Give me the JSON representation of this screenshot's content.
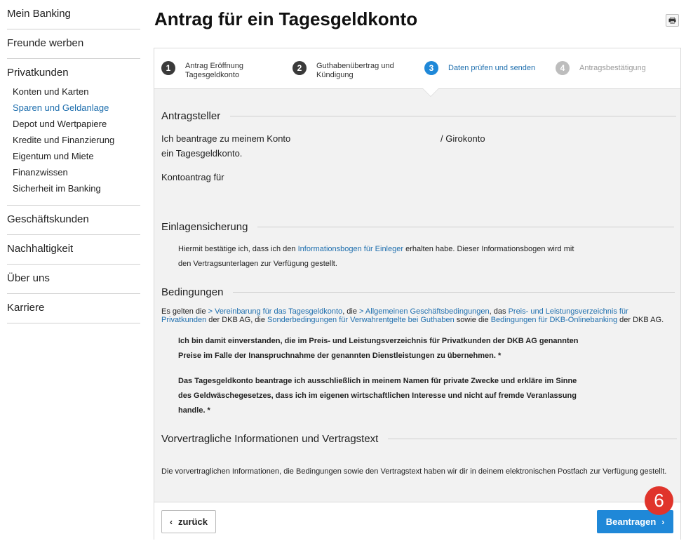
{
  "sidebar": {
    "top_items": [
      "Mein Banking",
      "Freunde werben"
    ],
    "privatkunden": {
      "label": "Privatkunden",
      "items": [
        "Konten und Karten",
        "Sparen und Geldanlage",
        "Depot und Wertpapiere",
        "Kredite und Finanzierung",
        "Eigentum und Miete",
        "Finanzwissen",
        "Sicherheit im Banking"
      ]
    },
    "bottom_items": [
      "Geschäftskunden",
      "Nachhaltigkeit",
      "Über uns",
      "Karriere"
    ]
  },
  "page": {
    "title": "Antrag für ein Tagesgeldkonto",
    "print_icon": "🖶"
  },
  "steps": [
    {
      "num": "1",
      "label": "Antrag Eröffnung Tagesgeldkonto",
      "state": "done"
    },
    {
      "num": "2",
      "label": "Guthabenübertrag und Kündigung",
      "state": "done"
    },
    {
      "num": "3",
      "label": "Daten prüfen und senden",
      "state": "current"
    },
    {
      "num": "4",
      "label": "Antragsbestätigung",
      "state": "future"
    }
  ],
  "antragsteller": {
    "title": "Antragsteller",
    "line1": "Ich beantrage zu meinem Konto",
    "line1_suffix": "/ Girokonto",
    "line2": "ein Tagesgeldkonto.",
    "line3": "Kontoantrag für"
  },
  "einlagensicherung": {
    "title": "Einlagensicherung",
    "text_before": "Hiermit bestätige ich, dass ich den ",
    "link": "Informationsbogen für Einleger",
    "text_after": " erhalten habe. Dieser Informationsbogen wird mit",
    "line2": "den Vertragsunterlagen zur Verfügung gestellt."
  },
  "bedingungen": {
    "title": "Bedingungen",
    "p1": "Es gelten die ",
    "l1": "> Vereinbarung für das Tagesgeldkonto",
    "p2": ", die ",
    "l2": "> Allgemeinen Geschäftsbedingungen",
    "p3": ", das ",
    "l3": "Preis- und Leistungsverzeichnis für Privatkunden",
    "p4": " der DKB AG, die ",
    "l4": "Sonderbedingungen für Verwahrentgelte bei Guthaben",
    "p5": " sowie die ",
    "l5": "Bedingungen für DKB-Onlinebanking",
    "p6": " der DKB AG.",
    "bold1": "Ich bin damit einverstanden, die im Preis- und Leistungsverzeichnis für Privatkunden der DKB AG genannten Preise im Falle der Inanspruchnahme der genannten Dienstleistungen zu übernehmen. *",
    "bold2": "Das Tagesgeldkonto beantrage ich ausschließlich in meinem Namen für private Zwecke und erkläre im Sinne des Geldwäschegesetzes, dass ich im eigenen wirtschaftlichen Interesse und nicht auf fremde Veranlassung handle. *"
  },
  "vorvertraglich": {
    "title": "Vorvertragliche Informationen und Vertragstext",
    "text": "Die vorvertraglichen Informationen, die Bedingungen sowie den Vertragstext haben wir dir in deinem elektronischen Postfach zur Verfügung gestellt."
  },
  "footer": {
    "back_label": "zurück",
    "next_label": "Beantragen",
    "chev_left": "‹",
    "chev_right": "›",
    "badge": "6"
  }
}
